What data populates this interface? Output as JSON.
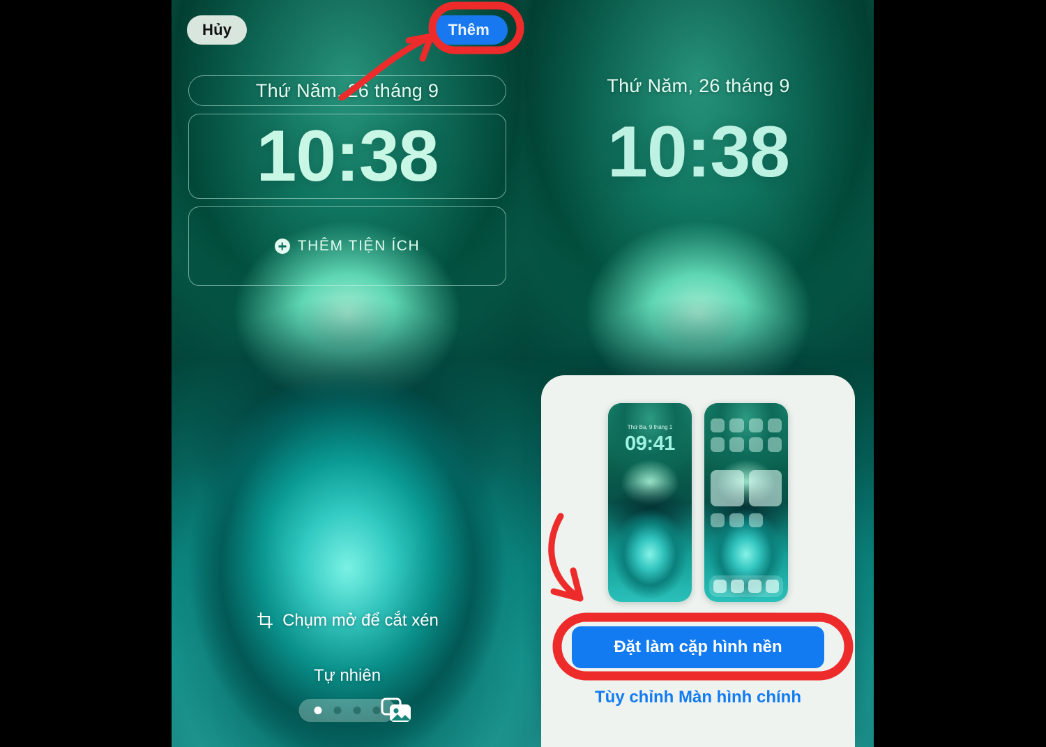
{
  "screen": {
    "bg_color": "#000000",
    "accent_blue": "#127bf2",
    "annotation_red": "#ee2b2b",
    "sheet_bg": "#eef3ef"
  },
  "left_panel": {
    "name": "lock-screen-editor",
    "cancel_label": "Hủy",
    "add_label": "Thêm",
    "date": "Thứ Năm, 26 tháng 9",
    "time": "10:38",
    "widget_add_label": "THÊM TIỆN ÍCH",
    "crop_hint": "Chụm mở để cắt xén",
    "style_label": "Tự nhiên",
    "page_dots": {
      "count": 4,
      "active_index": 0
    },
    "photos_icon": "photo-stack-icon",
    "more_icon": "ellipsis-circle-icon",
    "crop_icon": "crop-icon",
    "plus_icon": "plus-circle-icon"
  },
  "right_panel": {
    "name": "wallpaper-preview-confirm",
    "date": "Thứ Năm, 26 tháng 9",
    "time": "10:38",
    "sheet": {
      "lock_preview": {
        "name": "lock-screen-thumbnail",
        "date": "Thứ Ba, 9 tháng 1",
        "time": "09:41"
      },
      "home_preview": {
        "name": "home-screen-thumbnail",
        "icon_rows": 2,
        "icons_per_row": 4,
        "widget_count": 2,
        "second_row_icons": 3,
        "dock_icons": 4
      },
      "primary_button": "Đặt làm cặp hình nền",
      "secondary_link": "Tùy chỉnh Màn hình chính"
    }
  },
  "annotations": [
    {
      "name": "highlight-ring-add-button",
      "shape": "oval",
      "target": "Thêm"
    },
    {
      "name": "highlight-ring-set-pair-button",
      "shape": "rounded-rect",
      "target": "Đặt làm cặp hình nền"
    },
    {
      "name": "arrow-to-add-button",
      "shape": "curved-arrow",
      "direction": "up-right"
    },
    {
      "name": "arrow-to-set-pair-button",
      "shape": "curved-arrow",
      "direction": "down-right"
    }
  ]
}
